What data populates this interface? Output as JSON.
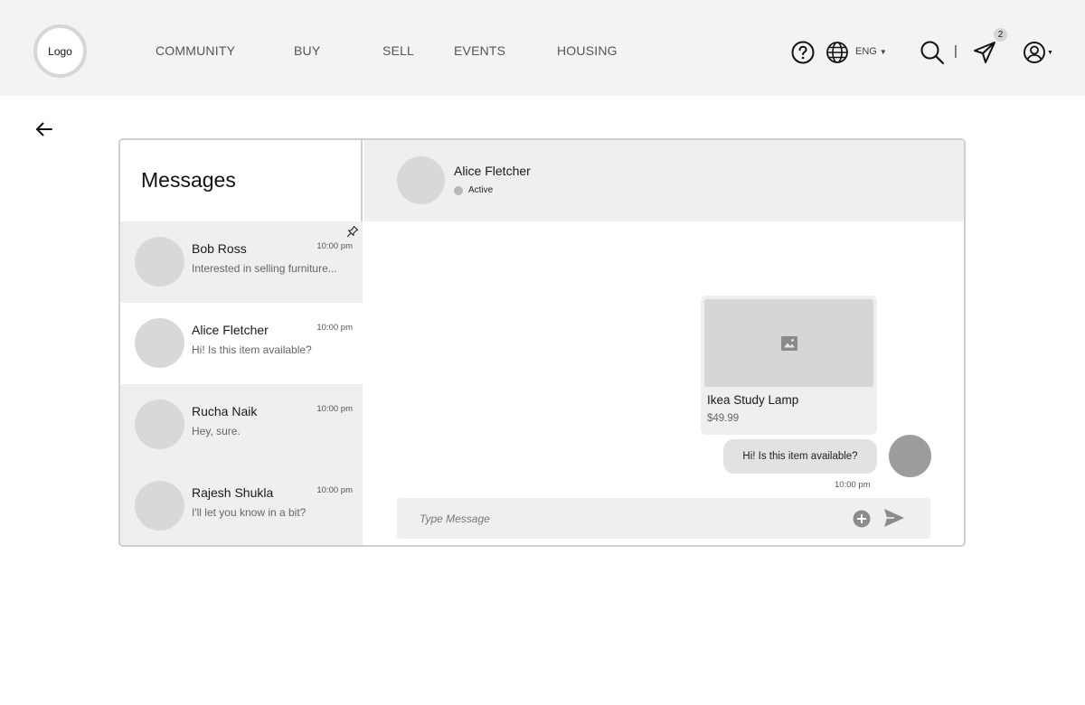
{
  "header": {
    "logo_label": "Logo",
    "nav": [
      "COMMUNITY",
      "BUY",
      "SELL",
      "EVENTS",
      "HOUSING"
    ],
    "language": "ENG",
    "separator": "|",
    "notification_count": "2",
    "icons": [
      "help-icon",
      "globe-icon",
      "search-icon",
      "send-icon",
      "user-icon"
    ]
  },
  "messages": {
    "title": "Messages",
    "conversations": [
      {
        "name": "Bob Ross",
        "preview": "Interested in selling furniture...",
        "time": "10:00 pm",
        "pinned": true
      },
      {
        "name": "Alice Fletcher",
        "preview": "Hi! Is this item available?",
        "time": "10:00 pm",
        "pinned": false
      },
      {
        "name": "Rucha Naik",
        "preview": "Hey, sure.",
        "time": "10:00 pm",
        "pinned": false
      },
      {
        "name": "Rajesh Shukla",
        "preview": "I'll let you know in a bit?",
        "time": "10:00 pm",
        "pinned": false
      }
    ]
  },
  "chat": {
    "contact_name": "Alice Fletcher",
    "status": "Active",
    "product": {
      "name": "Ikea Study Lamp",
      "price": "$49.99"
    },
    "message": {
      "text": "Hi! Is this item available?",
      "time": "10:00 pm"
    },
    "composer_placeholder": "Type Message"
  },
  "colors": {
    "header_bg": "#f3f3f3",
    "active_row_bg": "#efefef",
    "border": "#cfcfcf",
    "avatar": "#d8d8d8"
  }
}
